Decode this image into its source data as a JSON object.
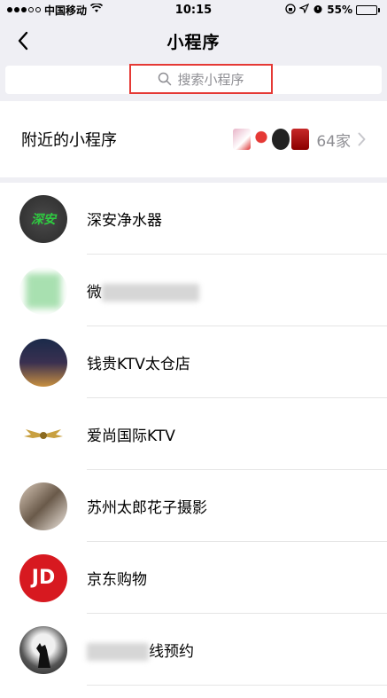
{
  "status_bar": {
    "carrier": "中国移动",
    "time": "10:15",
    "battery": "55%",
    "battery_level": 0.55
  },
  "nav": {
    "title": "小程序"
  },
  "search": {
    "placeholder": "搜索小程序"
  },
  "nearby": {
    "label": "附近的小程序",
    "count": "64家"
  },
  "mini_programs": [
    {
      "name": "深安净水器",
      "avatar_text": "深安"
    },
    {
      "name": "微",
      "avatar_text": ""
    },
    {
      "name": "钱贵KTV太仓店",
      "avatar_text": ""
    },
    {
      "name": "爱尚国际KTV",
      "avatar_text": ""
    },
    {
      "name": "苏州太郎花子摄影",
      "avatar_text": ""
    },
    {
      "name": "京东购物",
      "avatar_text": "JD"
    },
    {
      "name": "线预约",
      "avatar_text": ""
    }
  ],
  "colors": {
    "highlight_border": "#e53935",
    "jd_red": "#d71920"
  }
}
